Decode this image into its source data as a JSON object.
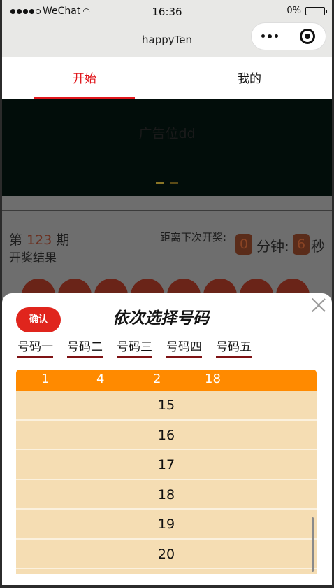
{
  "status_bar": {
    "carrier": "WeChat",
    "time": "16:36",
    "battery": "0%"
  },
  "nav": {
    "title": "happyTen"
  },
  "tabs": [
    {
      "label": "开始",
      "active": true
    },
    {
      "label": "我的",
      "active": false
    }
  ],
  "banner": {
    "ad_text": "广告位dd"
  },
  "draw_info": {
    "issue_prefix": "第",
    "issue_number": "123",
    "issue_suffix": "期",
    "result_label": "开奖结果",
    "countdown_label": "距离下次开奖:",
    "minutes": "0",
    "minutes_unit": "分钟:",
    "seconds": "6",
    "seconds_unit": "秒"
  },
  "picker": {
    "confirm_label": "确认",
    "title": "依次选择号码",
    "number_tabs": [
      "号码一",
      "号码二",
      "号码三",
      "号码四",
      "号码五"
    ],
    "selected": [
      "1",
      "4",
      "2",
      "18"
    ],
    "options": [
      "15",
      "16",
      "17",
      "18",
      "19",
      "20"
    ]
  },
  "colors": {
    "accent_red": "#e0161b",
    "selected_bar": "#ff8a00",
    "list_bg": "#f5ddb3"
  }
}
